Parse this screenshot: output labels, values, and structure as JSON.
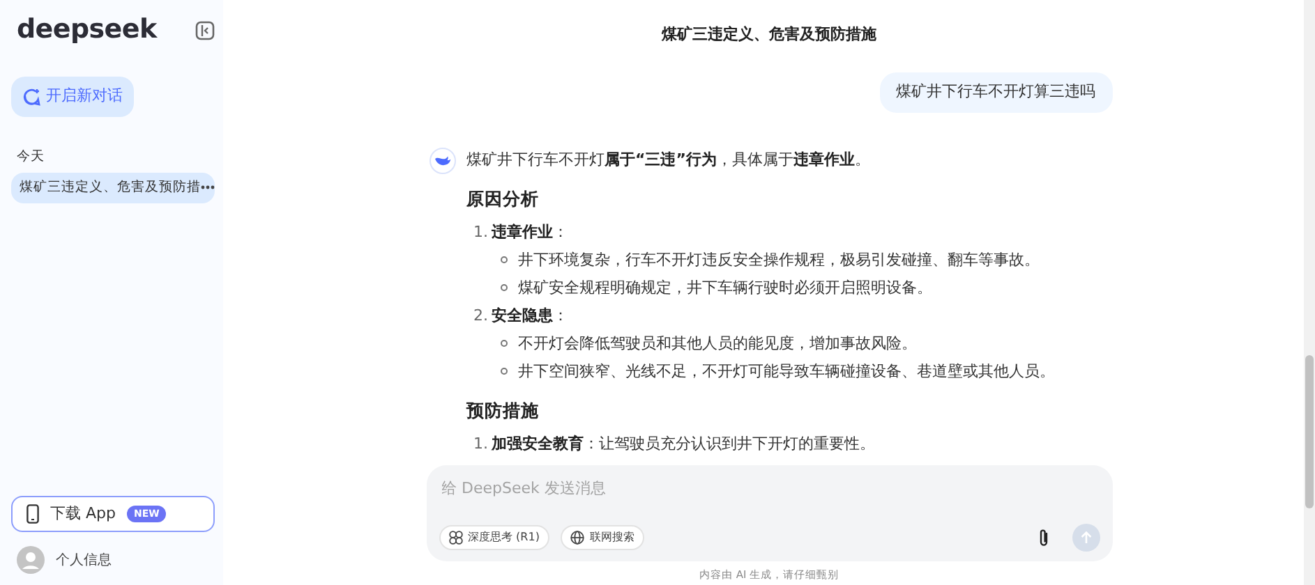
{
  "sidebar": {
    "logo": "deepseek",
    "new_chat_button": "开启新对话",
    "history_groups": [
      {
        "label": "今天",
        "items": [
          {
            "title": "煤矿三违定义、危害及预防措",
            "selected": true
          }
        ]
      }
    ],
    "download_button": {
      "label": "下载 App",
      "badge": "NEW"
    },
    "profile": {
      "label": "个人信息"
    }
  },
  "conversation": {
    "title": "煤矿三违定义、危害及预防措施",
    "messages": [
      {
        "kind": "user",
        "text": "煤矿井下行车不开灯算三违吗"
      },
      {
        "kind": "assistant",
        "blocks": [
          {
            "kind": "paragraph",
            "text": "煤矿井下行车不开灯**属于“三违”行为**，具体属于**违章作业**。"
          },
          {
            "kind": "heading",
            "text": "原因分析"
          },
          {
            "kind": "list",
            "items": [
              {
                "number": "1.",
                "text": "**违章作业**：",
                "bullets": [
                  "井下环境复杂，行车不开灯违反安全操作规程，极易引发碰撞、翻车等事故。",
                  "煤矿安全规程明确规定，井下车辆行驶时必须开启照明设备。"
                ]
              },
              {
                "number": "2.",
                "text": "**安全隐患**：",
                "bullets": [
                  "不开灯会降低驾驶员和其他人员的能见度，增加事故风险。",
                  "井下空间狭窄、光线不足，不开灯可能导致车辆碰撞设备、巷道壁或其他人员。"
                ]
              }
            ]
          },
          {
            "kind": "heading",
            "text": "预防措施"
          },
          {
            "kind": "list",
            "items": [
              {
                "number": "1.",
                "text": "**加强安全教育**：让驾驶员充分认识到井下开灯的重要性。"
              }
            ]
          }
        ]
      }
    ]
  },
  "composer": {
    "placeholder": "给 DeepSeek 发送消息",
    "toggles": [
      {
        "label": "深度思考 (R1)",
        "kind": "think",
        "selected": false
      },
      {
        "label": "联网搜索",
        "kind": "search",
        "selected": false
      }
    ],
    "send_disabled": true
  },
  "disclaimer": "内容由 AI 生成，请仔细甄别"
}
